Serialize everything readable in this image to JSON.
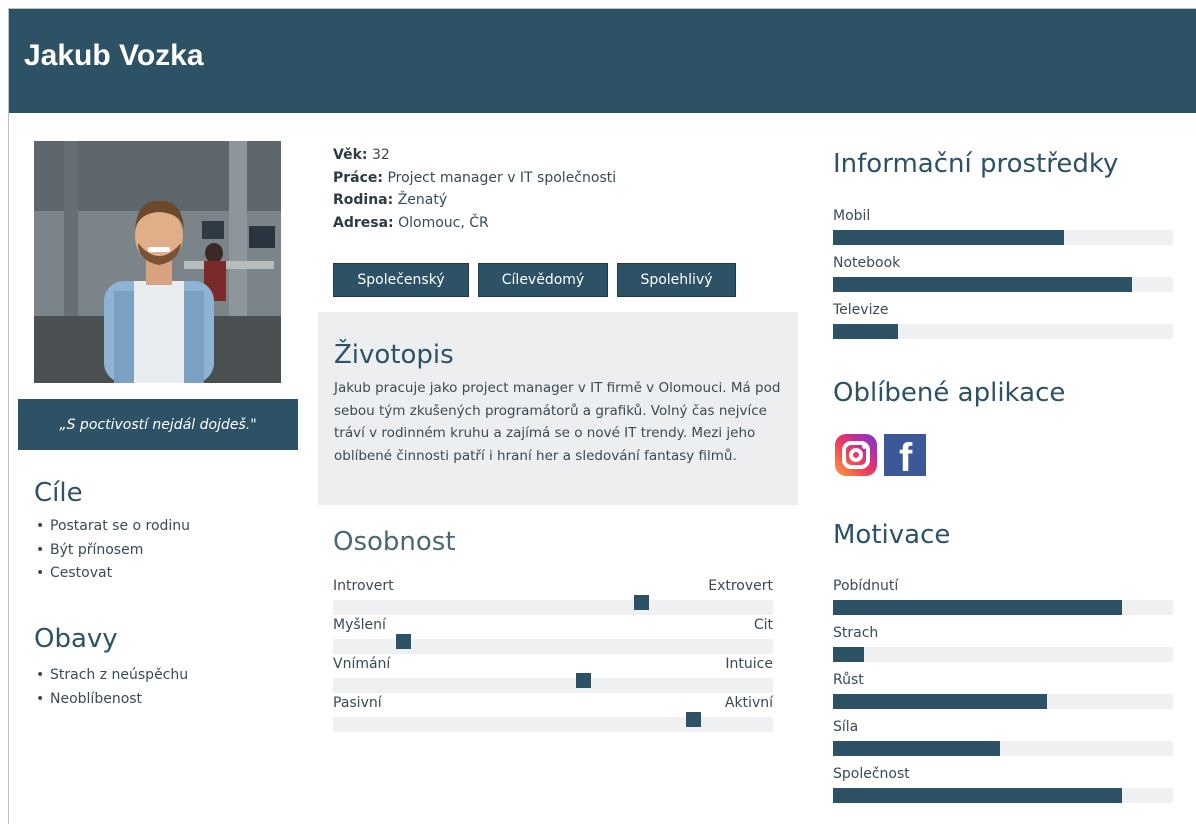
{
  "persona": {
    "name": "Jakub Vozka",
    "quote": "„S poctivostí nejdál dojdeš.\"",
    "facts": [
      {
        "label": "Věk:",
        "value": "32"
      },
      {
        "label": "Práce:",
        "value": "Project manager v IT společnosti"
      },
      {
        "label": "Rodina:",
        "value": "Ženatý"
      },
      {
        "label": "Adresa:",
        "value": "Olomouc, ČR"
      }
    ],
    "traits": [
      "Společenský",
      "Cílevědomý",
      "Spolehlivý"
    ]
  },
  "goals": {
    "title": "Cíle",
    "items": [
      "Postarat se o rodinu",
      "Být přínosem",
      "Cestovat"
    ]
  },
  "concerns": {
    "title": "Obavy",
    "items": [
      "Strach z neúspěchu",
      "Neoblíbenost"
    ]
  },
  "bio": {
    "title": "Životopis",
    "text": "Jakub pracuje jako project manager v IT firmě v Olomouci. Má pod sebou tým zkušených programátorů a grafiků. Volný čas nejvíce tráví v rodinném kruhu a zajímá se o nové IT trendy. Mezi jeho oblíbené činnosti patří i hraní her a sledování fantasy filmů."
  },
  "personality": {
    "title": "Osobnost",
    "scales": [
      {
        "left": "Introvert",
        "right": "Extrovert",
        "value": 0.7
      },
      {
        "left": "Myšlení",
        "right": "Cit",
        "value": 0.16
      },
      {
        "left": "Vnímání",
        "right": "Intuice",
        "value": 0.57
      },
      {
        "left": "Pasivní",
        "right": "Aktivní",
        "value": 0.82
      }
    ]
  },
  "media": {
    "title": "Informační prostředky",
    "items": [
      {
        "label": "Mobil",
        "value": 0.68
      },
      {
        "label": "Notebook",
        "value": 0.88
      },
      {
        "label": "Televize",
        "value": 0.19
      }
    ]
  },
  "apps": {
    "title": "Oblíbené aplikace",
    "icons": [
      "instagram-icon",
      "facebook-icon"
    ],
    "facebook_glyph": "f"
  },
  "motivation": {
    "title": "Motivace",
    "items": [
      {
        "label": "Pobídnutí",
        "value": 0.85
      },
      {
        "label": "Strach",
        "value": 0.09
      },
      {
        "label": "Růst",
        "value": 0.63
      },
      {
        "label": "Síla",
        "value": 0.49
      },
      {
        "label": "Společnost",
        "value": 0.85
      }
    ]
  },
  "colors": {
    "accent": "#2d5266",
    "track": "#eef0f2",
    "panel": "#eceef0"
  }
}
